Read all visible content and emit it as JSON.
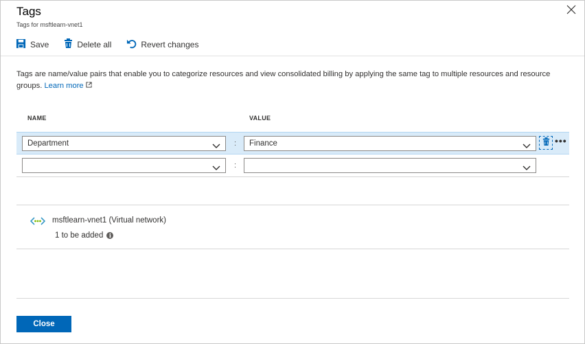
{
  "header": {
    "title": "Tags",
    "subtitle": "Tags for msftlearn-vnet1"
  },
  "toolbar": {
    "save_label": "Save",
    "delete_all_label": "Delete all",
    "revert_label": "Revert changes"
  },
  "description": {
    "text": "Tags are name/value pairs that enable you to categorize resources and view consolidated billing by applying the same tag to multiple resources and resource groups.",
    "learn_more": "Learn more"
  },
  "columns": {
    "name": "NAME",
    "value": "VALUE"
  },
  "tags": [
    {
      "name": "Department",
      "separator": ":",
      "value": "Finance"
    },
    {
      "name": "",
      "separator": ":",
      "value": ""
    }
  ],
  "resource": {
    "name": "msftlearn-vnet1",
    "type": "(Virtual network)",
    "status": "1 to be added",
    "icon": "virtual-network-icon"
  },
  "footer": {
    "close_label": "Close"
  },
  "colors": {
    "accent": "#0067b8",
    "selected_row": "#d9ebf9",
    "vnet_green": "#7fba00",
    "vnet_blue": "#3999c6"
  }
}
